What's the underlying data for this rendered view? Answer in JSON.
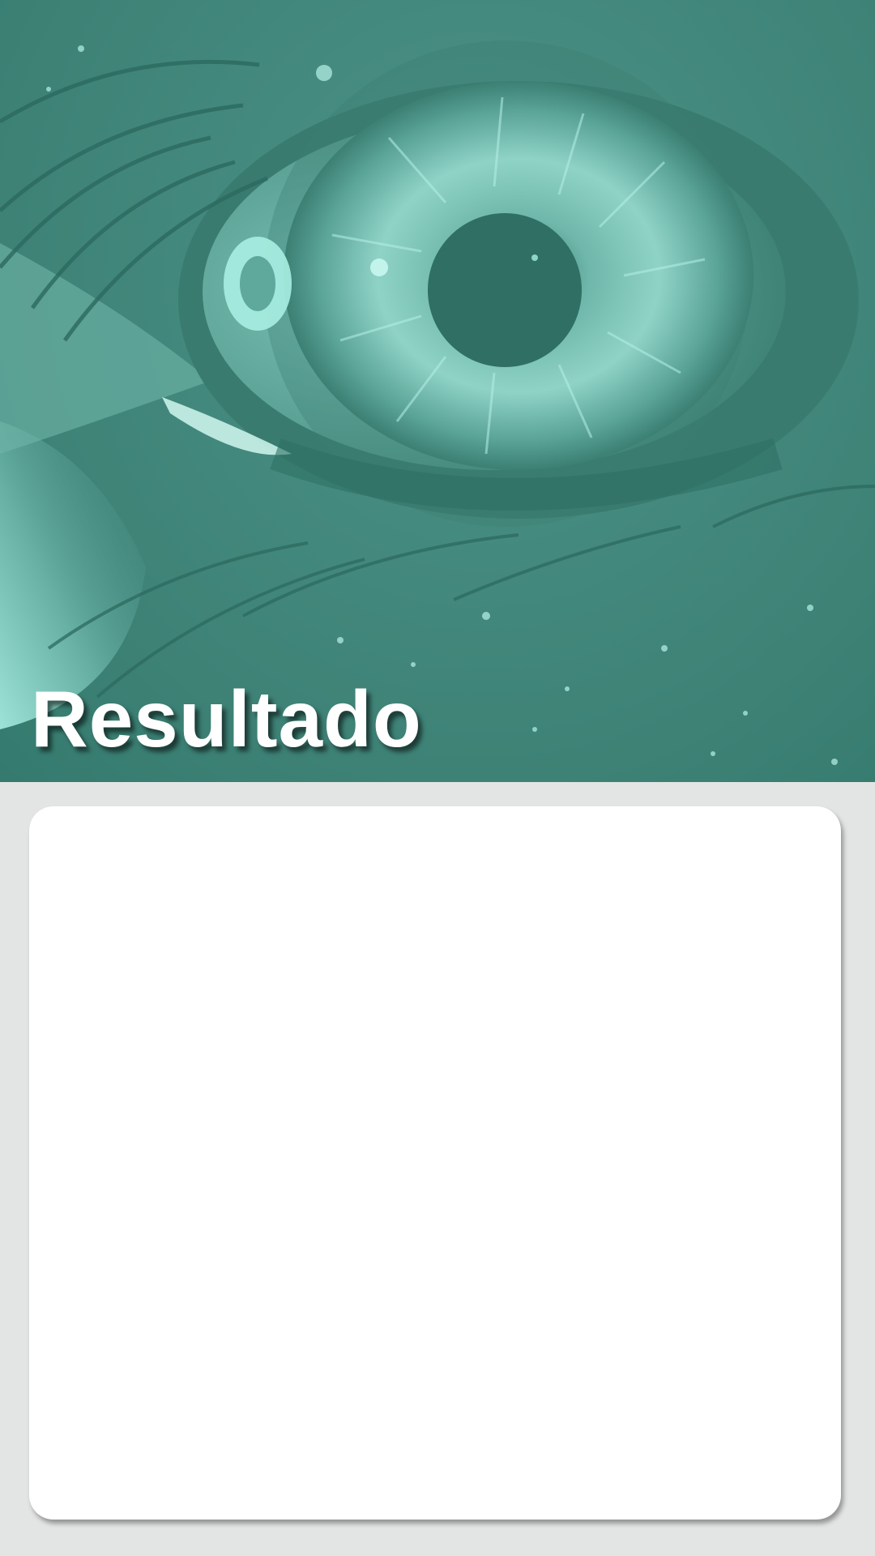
{
  "header": {
    "title": "Resultado",
    "image": "eye-closeup-photo",
    "tint_color": "#3e8276",
    "highlight_color": "#a8eee2"
  },
  "result": {
    "content": ""
  },
  "colors": {
    "background": "#e3e5e4",
    "card": "#ffffff",
    "title_text": "#ffffff"
  }
}
